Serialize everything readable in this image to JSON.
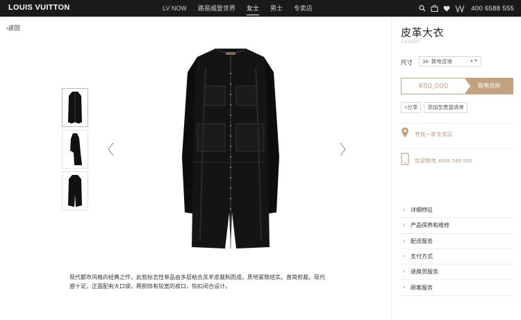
{
  "header": {
    "brand": "LOUIS VUITTON",
    "nav": [
      "LV NOW",
      "路易威登世界",
      "女士",
      "男士",
      "专卖店"
    ],
    "active_nav": "女士",
    "phone": "400 6588 555",
    "icons": [
      "search-icon",
      "bag-icon",
      "heart-icon",
      "monogram-logo"
    ]
  },
  "back_label": "返回",
  "product": {
    "title": "皮革大衣",
    "sku": "1A3HOP",
    "size_label": "尺寸",
    "size_value": "34- 致电咨询",
    "price": "¥80,000",
    "call_label": "致电咨询",
    "share_label": "分享",
    "wishlist_label": "添加至愿望清单",
    "store_label": "寻找一家专卖店",
    "phone_label": "欢迎致电 4006 588 555",
    "description": "现代都市风格的经典之作，此款标志性单品由多层粘合羔羊皮裁制而成，质地紧致结实。直简剪裁，现代感十足，正面配有大口袋，两侧饰有较宽的衩口，钩扣闭合设计。"
  },
  "accordion": [
    "详细特征",
    "产品保养和维修",
    "配送服务",
    "支付方式",
    "退换货服务",
    "顾客服务"
  ],
  "colors": {
    "accent": "#c2a27f",
    "topbar": "#1a1a1a",
    "coat": "#111111"
  }
}
